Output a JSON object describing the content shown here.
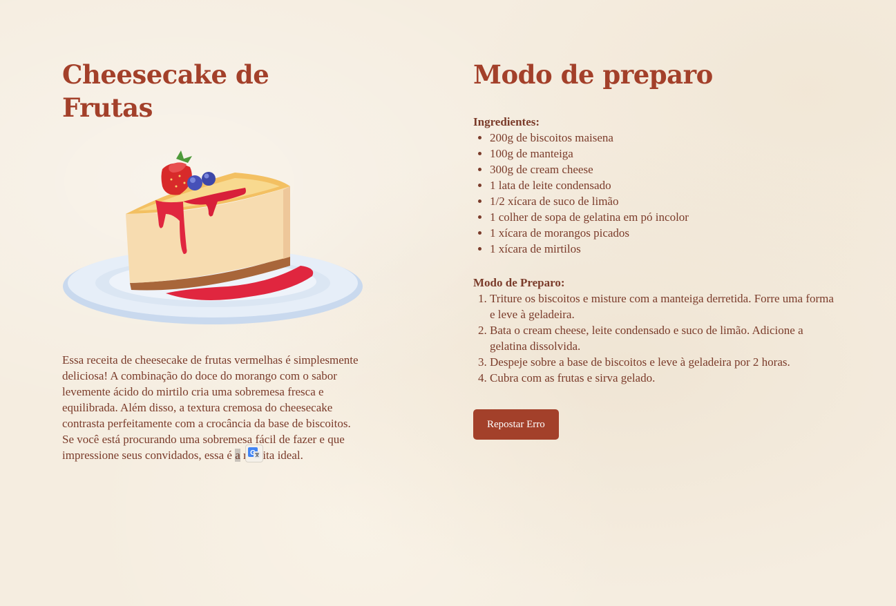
{
  "left": {
    "title": "Cheesecake de Frutas",
    "description_before": "Essa receita de cheesecake de frutas vermelhas é simplesmente deliciosa! A combinação do doce do morango com o sabor levemente ácido do mirtilo cria uma sobremesa fresca e equilibrada. Além disso, a textura cremosa do cheesecake contrasta perfeitamente com a crocância da base de biscoitos. Se você está procurando uma sobremesa fácil de fazer e que impressione seus convidados, essa é ",
    "description_highlight": "a",
    "description_after": " receita ideal.",
    "image_icon": "cheesecake-illustration",
    "translate_icon": "google-translate-icon"
  },
  "right": {
    "title": "Modo de preparo",
    "ingredients_heading": "Ingredientes:",
    "ingredients": [
      "200g de biscoitos maisena",
      "100g de manteiga",
      "300g de cream cheese",
      "1 lata de leite condensado",
      "1/2 xícara de suco de limão",
      "1 colher de sopa de gelatina em pó incolor",
      "1 xícara de morangos picados",
      "1 xícara de mirtilos"
    ],
    "steps_heading": "Modo de Preparo:",
    "steps": [
      "Triture os biscoitos e misture com a manteiga derretida. Forre uma forma e leve à geladeira.",
      "Bata o cream cheese, leite condensado e suco de limão. Adicione a gelatina dissolvida.",
      "Despeje sobre a base de biscoitos e leve à geladeira por 2 horas.",
      "Cubra com as frutas e sirva gelado."
    ],
    "report_button": "Repostar Erro"
  },
  "colors": {
    "accent": "#a3402a",
    "text": "#7a3b2a",
    "background": "#f5ede0"
  }
}
